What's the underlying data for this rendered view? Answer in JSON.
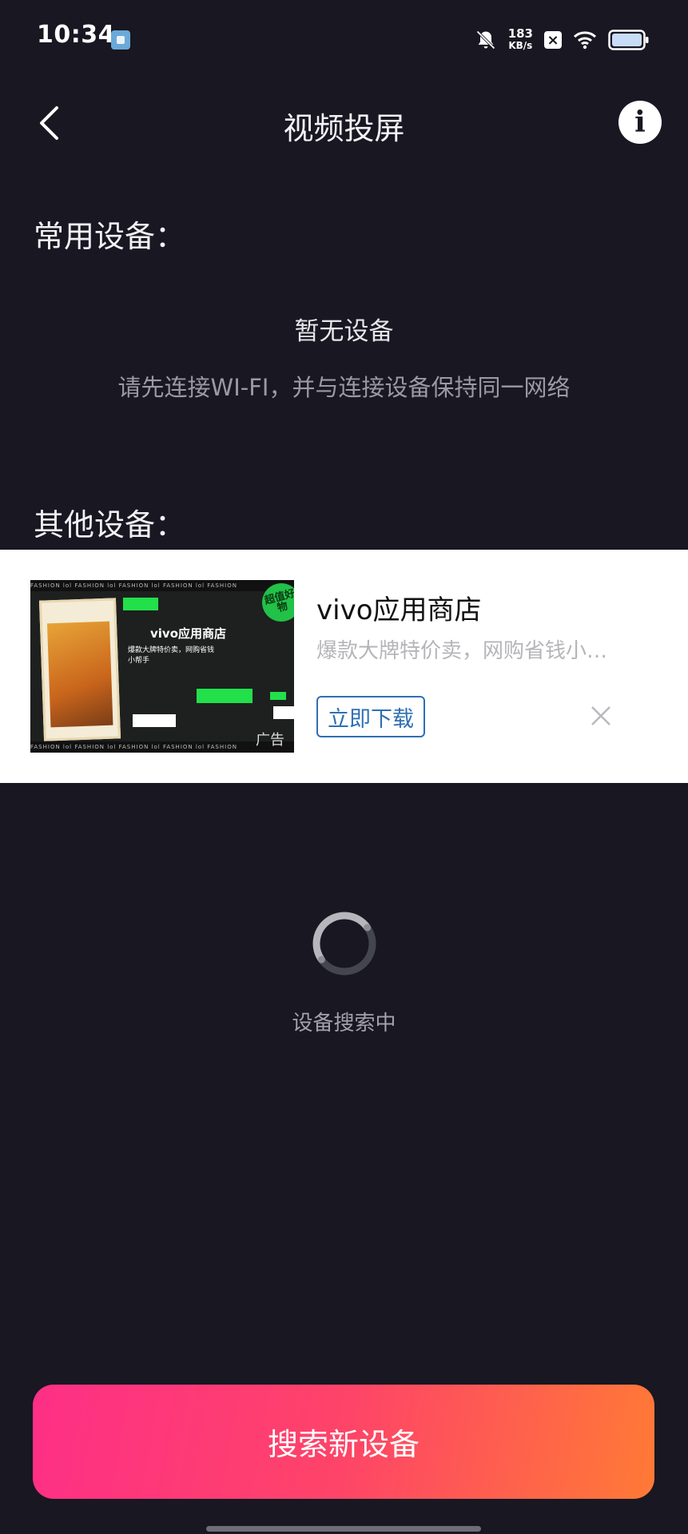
{
  "status_bar": {
    "time": "10:34",
    "net_speed_value": "183",
    "net_speed_unit": "KB/s",
    "icons": [
      "app-notification-icon",
      "bell-muted-icon",
      "sim-x-icon",
      "wifi-icon",
      "battery-icon"
    ]
  },
  "header": {
    "title": "视频投屏",
    "info_glyph": "i"
  },
  "frequent_devices": {
    "label": "常用设备：",
    "empty_title": "暂无设备",
    "empty_desc": "请先连接WI-FI，并与连接设备保持同一网络"
  },
  "other_devices": {
    "label": "其他设备："
  },
  "ad": {
    "app_name": "vivo应用商店",
    "description": "爆款大牌特价卖，网购省钱小…",
    "download_label": "立即下载",
    "tag": "广告",
    "thumb_title": "vivo应用商店",
    "thumb_sub": "爆款大牌特价卖，网购省钱小帮手",
    "thumb_badge": "超值好物",
    "thumb_strip": "FASHION  lol  FASHION  lol  FASHION  lol  FASHION  lol  FASHION"
  },
  "search": {
    "status_text": "设备搜索中",
    "button_label": "搜索新设备"
  },
  "colors": {
    "background": "#181722",
    "button_gradient_start": "#fe2f86",
    "button_gradient_end": "#ff7a35",
    "download_blue": "#2f6fb3"
  }
}
